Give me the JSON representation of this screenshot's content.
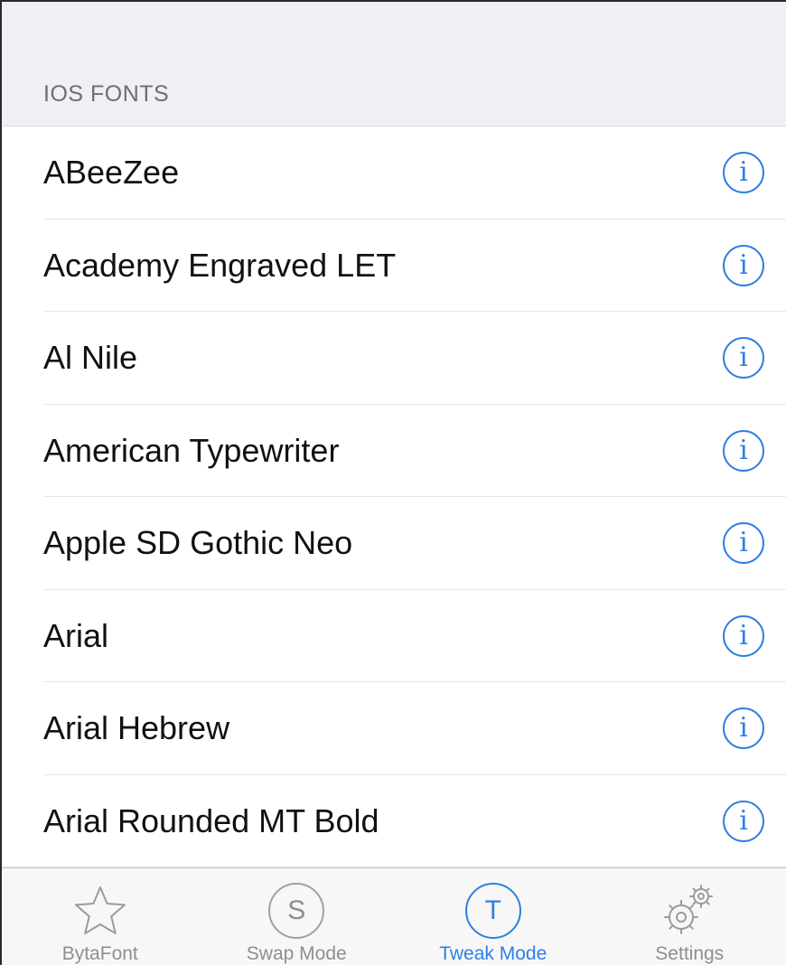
{
  "section": {
    "title": "IOS FONTS"
  },
  "fonts": [
    {
      "name": "ABeeZee"
    },
    {
      "name": "Academy Engraved LET"
    },
    {
      "name": "Al Nile"
    },
    {
      "name": "American Typewriter"
    },
    {
      "name": "Apple SD Gothic Neo"
    },
    {
      "name": "Arial"
    },
    {
      "name": "Arial Hebrew"
    },
    {
      "name": "Arial Rounded MT Bold"
    }
  ],
  "info_icon": {
    "glyph": "i",
    "icon": "info-circle-icon",
    "color": "#2f7fe3"
  },
  "tab_bar": {
    "tabs": [
      {
        "label": "BytaFont",
        "icon": "star-icon",
        "active": false
      },
      {
        "label": "Swap Mode",
        "icon": "circle-s-icon",
        "glyph": "S",
        "active": false
      },
      {
        "label": "Tweak Mode",
        "icon": "circle-t-icon",
        "glyph": "T",
        "active": true
      },
      {
        "label": "Settings",
        "icon": "gear-icon",
        "active": false
      }
    ]
  },
  "colors": {
    "accent": "#2f7fe3",
    "inactive": "#8e8e93",
    "header_bg": "#efeff4"
  }
}
